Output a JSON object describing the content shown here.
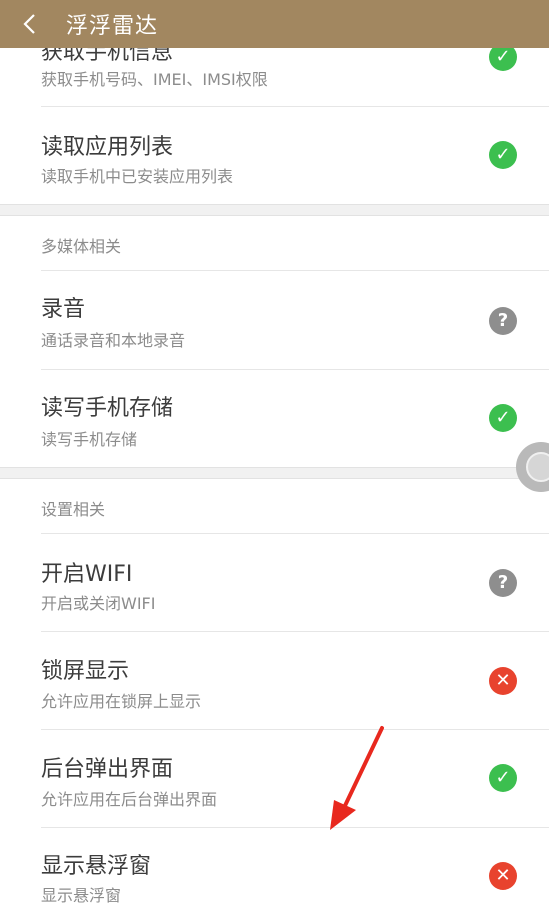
{
  "header": {
    "title": "浮浮雷达"
  },
  "colors": {
    "header_bg": "#a28760",
    "ok": "#3cbf4f",
    "unknown": "#8e8e8e",
    "denied": "#e8432e"
  },
  "items_top": [
    {
      "title": "获取手机信息",
      "desc": "获取手机号码、IMEI、IMSI权限",
      "status": "ok"
    },
    {
      "title": "读取应用列表",
      "desc": "读取手机中已安装应用列表",
      "status": "ok"
    }
  ],
  "section_media": {
    "label": "多媒体相关",
    "items": [
      {
        "title": "录音",
        "desc": "通话录音和本地录音",
        "status": "unknown"
      },
      {
        "title": "读写手机存储",
        "desc": "读写手机存储",
        "status": "ok"
      }
    ]
  },
  "section_settings": {
    "label": "设置相关",
    "items": [
      {
        "title": "开启WIFI",
        "desc": "开启或关闭WIFI",
        "status": "unknown"
      },
      {
        "title": "锁屏显示",
        "desc": "允许应用在锁屏上显示",
        "status": "denied"
      },
      {
        "title": "后台弹出界面",
        "desc": "允许应用在后台弹出界面",
        "status": "ok"
      },
      {
        "title": "显示悬浮窗",
        "desc": "显示悬浮窗",
        "status": "denied"
      }
    ]
  },
  "icons": {
    "back": "chevron-left-icon",
    "ok": "check-circle-icon",
    "unknown": "question-circle-icon",
    "denied": "cross-circle-icon",
    "float_ball": "floating-ball-icon",
    "annotation": "red-arrow-icon"
  }
}
